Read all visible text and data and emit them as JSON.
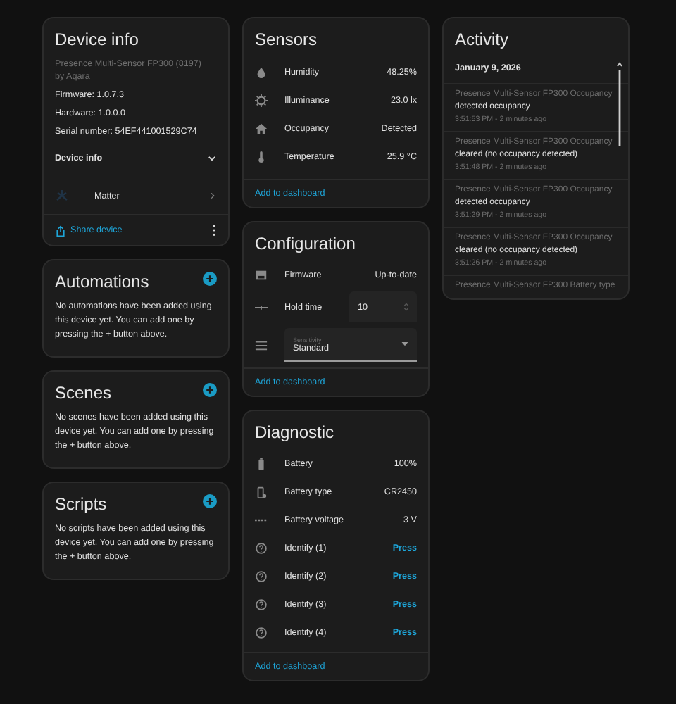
{
  "device_info": {
    "title": "Device info",
    "model": "Presence Multi-Sensor FP300 (8197)",
    "manufacturer": "by Aqara",
    "details": [
      "Firmware: 1.0.7.3",
      "Hardware: 1.0.0.0",
      "Serial number: 54EF441001529C74"
    ],
    "section": {
      "label": "Device info",
      "expanded": false
    },
    "integration": "Matter",
    "share": "Share device"
  },
  "empty_cards": [
    {
      "title": "Automations",
      "text": "No automations have been added using this device yet. You can add one by pressing the + button above."
    },
    {
      "title": "Scenes",
      "text": "No scenes have been added using this device yet. You can add one by pressing the + button above."
    },
    {
      "title": "Scripts",
      "text": "No scripts have been added using this device yet. You can add one by pressing the + button above."
    }
  ],
  "sensors": {
    "title": "Sensors",
    "rows": [
      {
        "kind": "drop",
        "label": "Humidity",
        "value": "48.25%"
      },
      {
        "kind": "sun",
        "label": "Illuminance",
        "value": "23.0 lx"
      },
      {
        "kind": "home",
        "label": "Occupancy",
        "value": "Detected"
      },
      {
        "kind": "thermo",
        "label": "Temperature",
        "value": "25.9 °C"
      }
    ],
    "action": "Add to dashboard"
  },
  "configuration": {
    "title": "Configuration",
    "firmware": {
      "label": "Firmware",
      "value": "Up-to-date"
    },
    "hold_time": {
      "label": "Hold time",
      "value": "10"
    },
    "sensitivity": {
      "label": "Sensitivity",
      "value": "Standard"
    },
    "action": "Add to dashboard"
  },
  "diagnostic": {
    "title": "Diagnostic",
    "rows": [
      {
        "kind": "battery",
        "label": "Battery",
        "value": "100%"
      },
      {
        "kind": "battery_type",
        "label": "Battery type",
        "value": "CR2450"
      },
      {
        "kind": "voltage",
        "label": "Battery voltage",
        "value": "3 V"
      },
      {
        "kind": "button",
        "label": "Identify (1)",
        "value": "Press"
      },
      {
        "kind": "button",
        "label": "Identify (2)",
        "value": "Press"
      },
      {
        "kind": "button",
        "label": "Identify (3)",
        "value": "Press"
      },
      {
        "kind": "button",
        "label": "Identify (4)",
        "value": "Press"
      }
    ],
    "action": "Add to dashboard"
  },
  "activity": {
    "title": "Activity",
    "date": "January 9, 2026",
    "events": [
      {
        "source": "Presence Multi-Sensor FP300 Occupancy",
        "message": "detected occupancy",
        "time": "3:51:53 PM - 2 minutes ago"
      },
      {
        "source": "Presence Multi-Sensor FP300 Occupancy",
        "message": "cleared (no occupancy detected)",
        "time": "3:51:48 PM - 2 minutes ago"
      },
      {
        "source": "Presence Multi-Sensor FP300 Occupancy",
        "message": "detected occupancy",
        "time": "3:51:29 PM - 2 minutes ago"
      },
      {
        "source": "Presence Multi-Sensor FP300 Occupancy",
        "message": "cleared (no occupancy detected)",
        "time": "3:51:26 PM - 2 minutes ago"
      },
      {
        "source": "Presence Multi-Sensor FP300 Battery type"
      }
    ]
  }
}
